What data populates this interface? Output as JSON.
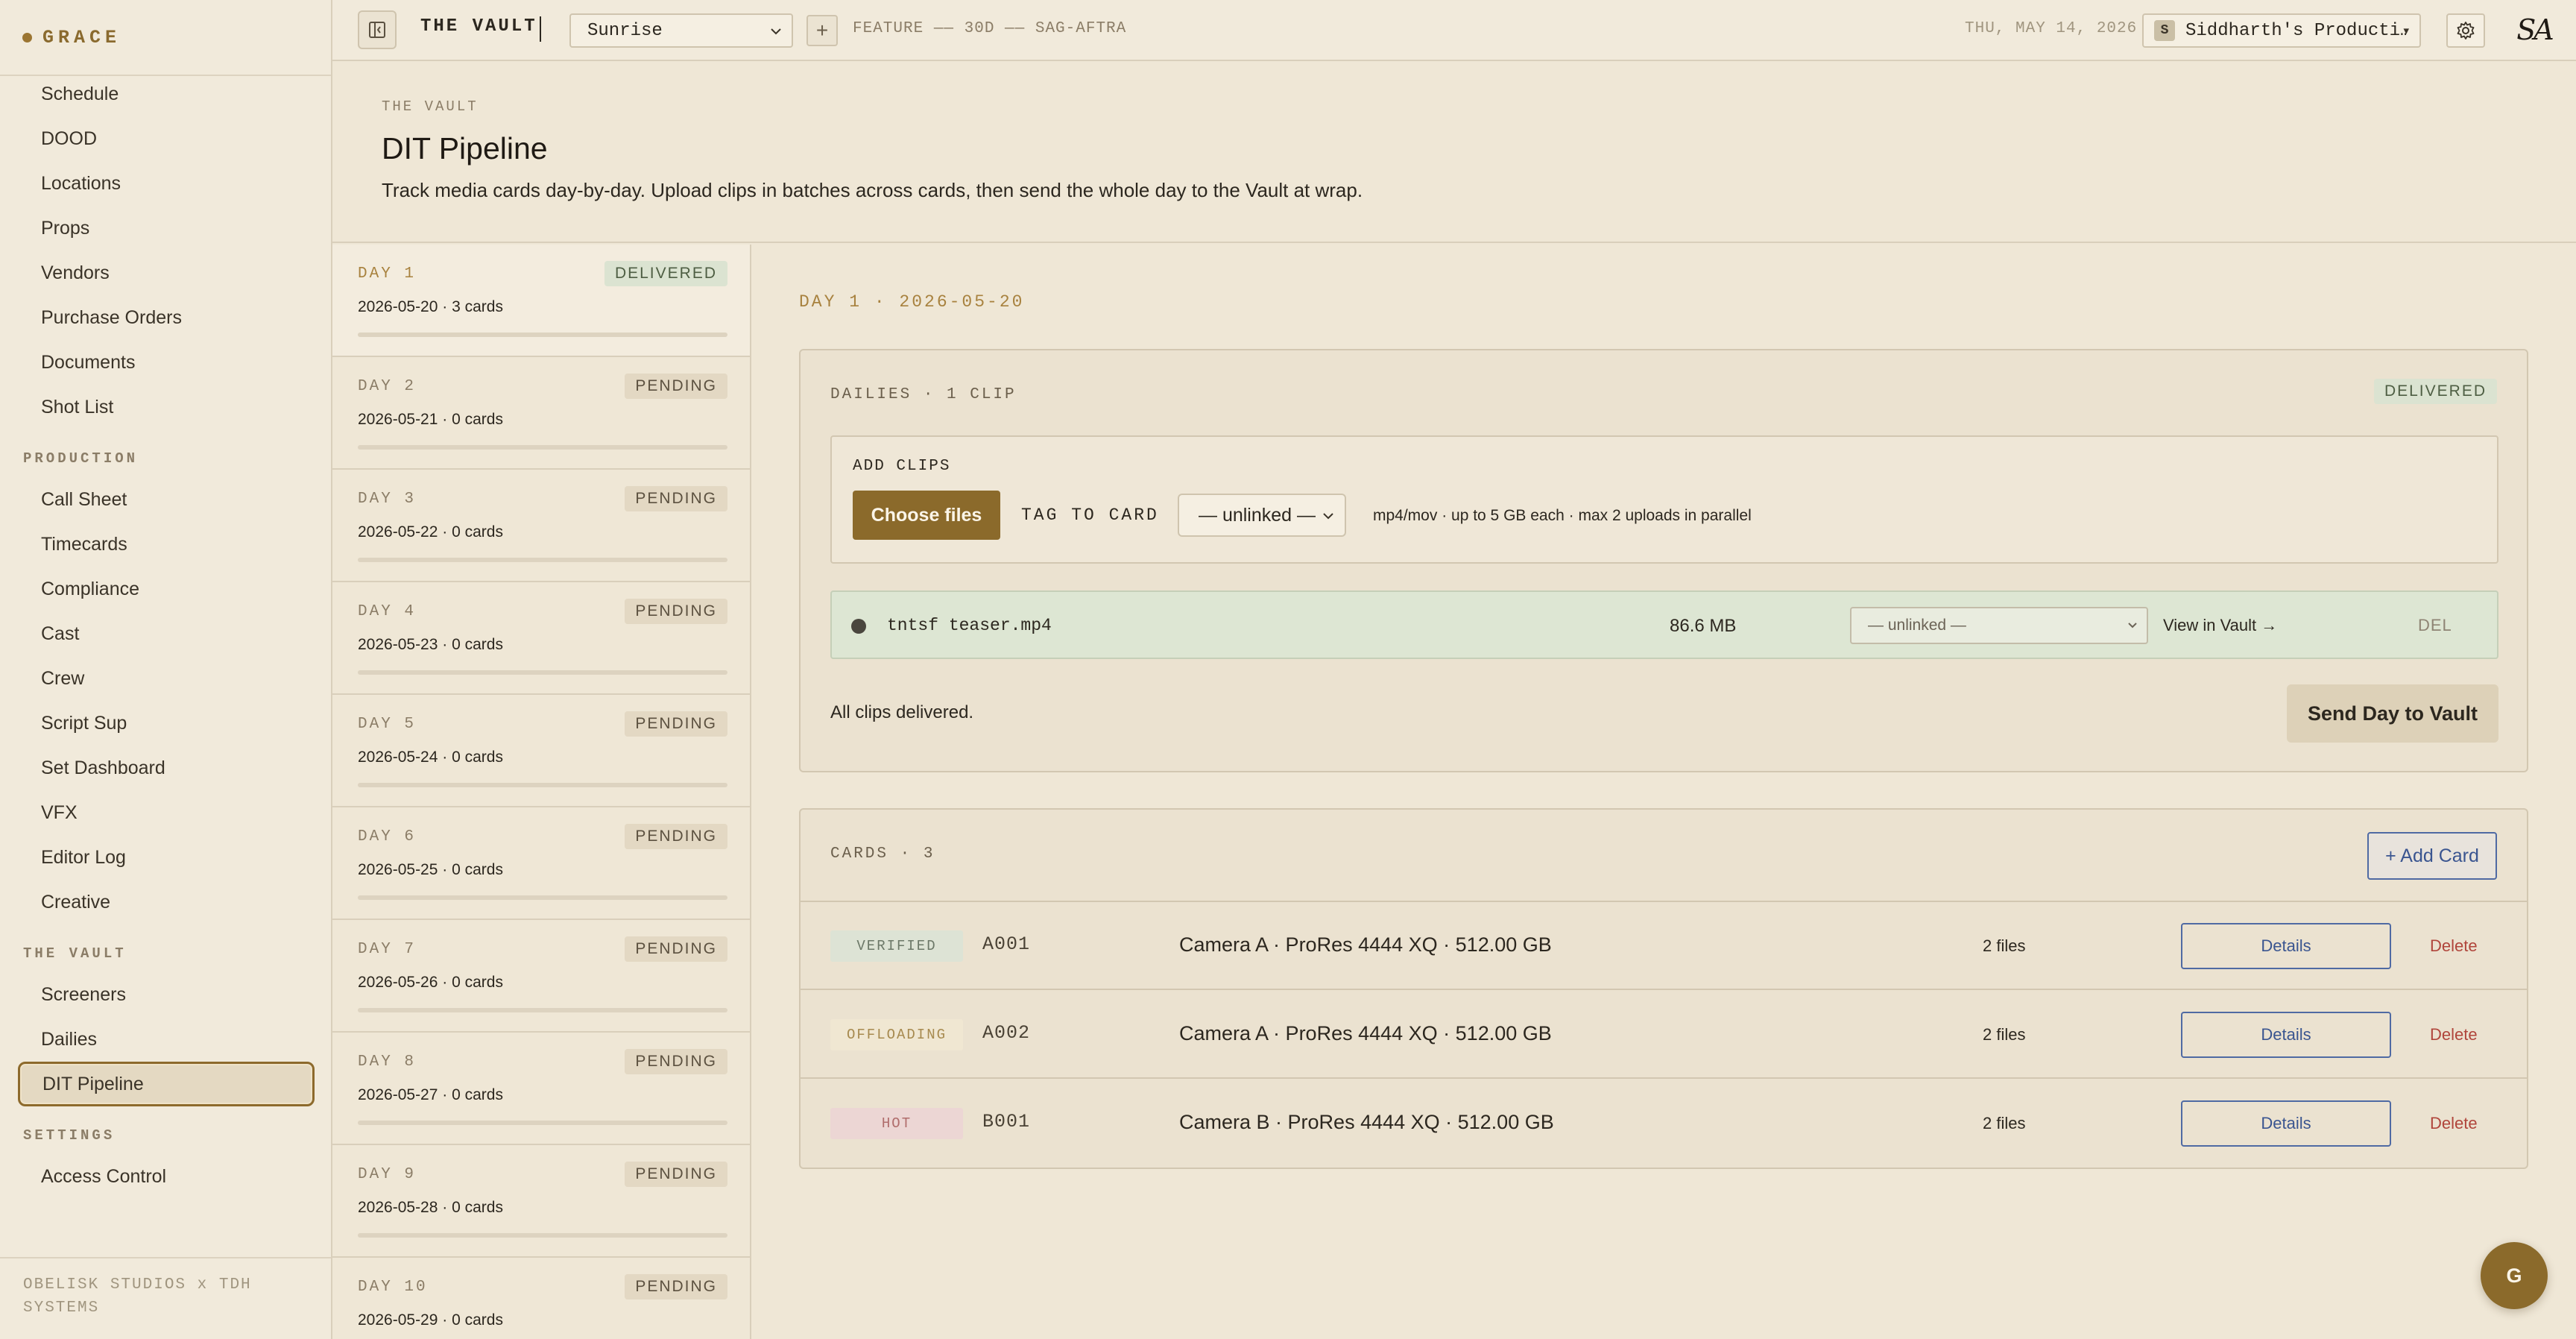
{
  "brand": {
    "name": "GRACE"
  },
  "sidebar": {
    "items_top": [
      {
        "label": "Schedule"
      },
      {
        "label": "DOOD"
      },
      {
        "label": "Locations"
      },
      {
        "label": "Props"
      },
      {
        "label": "Vendors"
      },
      {
        "label": "Purchase Orders"
      },
      {
        "label": "Documents"
      },
      {
        "label": "Shot List"
      }
    ],
    "production_heading": "PRODUCTION",
    "production_items": [
      {
        "label": "Call Sheet"
      },
      {
        "label": "Timecards"
      },
      {
        "label": "Compliance"
      },
      {
        "label": "Cast"
      },
      {
        "label": "Crew"
      },
      {
        "label": "Script Sup"
      },
      {
        "label": "Set Dashboard"
      },
      {
        "label": "VFX"
      },
      {
        "label": "Editor Log"
      },
      {
        "label": "Creative"
      }
    ],
    "vault_heading": "THE VAULT",
    "vault_items": [
      {
        "label": "Screeners"
      },
      {
        "label": "Dailies"
      },
      {
        "label": "DIT Pipeline",
        "active": true
      }
    ],
    "settings_heading": "SETTINGS",
    "settings_items": [
      {
        "label": "Access Control"
      }
    ],
    "footer": "OBELISK STUDIOS x TDH SYSTEMS"
  },
  "topbar": {
    "section": "THE VAULT",
    "project": "Sunrise",
    "project_meta": "FEATURE —— 30D —— SAG-AFTRA",
    "date": "THU, MAY 14, 2026",
    "org_badge": "S",
    "org_name": "Siddharth's Producti…",
    "user_logo": "SA",
    "add_label": "+"
  },
  "header": {
    "eyebrow": "THE VAULT",
    "title": "DIT Pipeline",
    "description": "Track media cards day-by-day. Upload clips in batches across cards, then send the whole day to the Vault at wrap."
  },
  "days": [
    {
      "label": "DAY 1",
      "meta": "2026-05-20 · 3 cards",
      "status": "DELIVERED",
      "active": true
    },
    {
      "label": "DAY 2",
      "meta": "2026-05-21 · 0 cards",
      "status": "PENDING"
    },
    {
      "label": "DAY 3",
      "meta": "2026-05-22 · 0 cards",
      "status": "PENDING"
    },
    {
      "label": "DAY 4",
      "meta": "2026-05-23 · 0 cards",
      "status": "PENDING"
    },
    {
      "label": "DAY 5",
      "meta": "2026-05-24 · 0 cards",
      "status": "PENDING"
    },
    {
      "label": "DAY 6",
      "meta": "2026-05-25 · 0 cards",
      "status": "PENDING"
    },
    {
      "label": "DAY 7",
      "meta": "2026-05-26 · 0 cards",
      "status": "PENDING"
    },
    {
      "label": "DAY 8",
      "meta": "2026-05-27 · 0 cards",
      "status": "PENDING"
    },
    {
      "label": "DAY 9",
      "meta": "2026-05-28 · 0 cards",
      "status": "PENDING"
    },
    {
      "label": "DAY 10",
      "meta": "2026-05-29 · 0 cards",
      "status": "PENDING"
    }
  ],
  "main": {
    "day_heading": "DAY 1 · 2026-05-20",
    "dailies": {
      "title": "DAILIES · 1 CLIP",
      "status": "DELIVERED",
      "add_clips_title": "ADD CLIPS",
      "choose_files": "Choose files",
      "tag_label": "TAG TO CARD",
      "tag_value": "— unlinked —",
      "hint": "mp4/mov · up to 5 GB each · max 2 uploads in parallel",
      "clips": [
        {
          "name": "tntsf teaser.mp4",
          "size": "86.6 MB",
          "card": "— unlinked —",
          "view": "View in Vault →",
          "del": "DEL"
        }
      ],
      "footer_text": "All clips delivered.",
      "send_button": "Send Day to Vault"
    },
    "cards": {
      "title": "CARDS · 3",
      "add_button": "+ Add Card",
      "rows": [
        {
          "status": "VERIFIED",
          "id": "A001",
          "desc": "Camera A · ProRes 4444 XQ · 512.00 GB",
          "files": "2 files",
          "details": "Details",
          "delete": "Delete"
        },
        {
          "status": "OFFLOADING",
          "id": "A002",
          "desc": "Camera A · ProRes 4444 XQ · 512.00 GB",
          "files": "2 files",
          "details": "Details",
          "delete": "Delete"
        },
        {
          "status": "HOT",
          "id": "B001",
          "desc": "Camera B · ProRes 4444 XQ · 512.00 GB",
          "files": "2 files",
          "details": "Details",
          "delete": "Delete"
        }
      ]
    }
  },
  "assistant": {
    "label": "G"
  }
}
